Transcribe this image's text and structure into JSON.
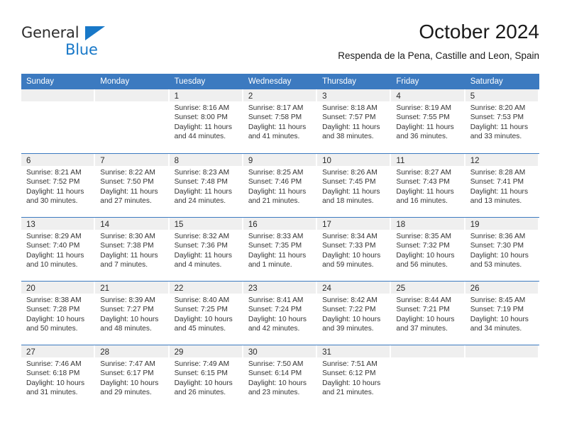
{
  "brand": {
    "name_part1": "General",
    "name_part2": "Blue",
    "triangle_color": "#1878c8"
  },
  "header": {
    "title": "October 2024",
    "subtitle": "Respenda de la Pena, Castille and Leon, Spain"
  },
  "theme": {
    "header_blue": "#3c7ac0",
    "band_gray": "#efefef",
    "text_color": "#333333"
  },
  "weekdays": [
    "Sunday",
    "Monday",
    "Tuesday",
    "Wednesday",
    "Thursday",
    "Friday",
    "Saturday"
  ],
  "weeks": [
    [
      {
        "day": ""
      },
      {
        "day": ""
      },
      {
        "day": "1",
        "sunrise": "Sunrise: 8:16 AM",
        "sunset": "Sunset: 8:00 PM",
        "daylight1": "Daylight: 11 hours",
        "daylight2": "and 44 minutes."
      },
      {
        "day": "2",
        "sunrise": "Sunrise: 8:17 AM",
        "sunset": "Sunset: 7:58 PM",
        "daylight1": "Daylight: 11 hours",
        "daylight2": "and 41 minutes."
      },
      {
        "day": "3",
        "sunrise": "Sunrise: 8:18 AM",
        "sunset": "Sunset: 7:57 PM",
        "daylight1": "Daylight: 11 hours",
        "daylight2": "and 38 minutes."
      },
      {
        "day": "4",
        "sunrise": "Sunrise: 8:19 AM",
        "sunset": "Sunset: 7:55 PM",
        "daylight1": "Daylight: 11 hours",
        "daylight2": "and 36 minutes."
      },
      {
        "day": "5",
        "sunrise": "Sunrise: 8:20 AM",
        "sunset": "Sunset: 7:53 PM",
        "daylight1": "Daylight: 11 hours",
        "daylight2": "and 33 minutes."
      }
    ],
    [
      {
        "day": "6",
        "sunrise": "Sunrise: 8:21 AM",
        "sunset": "Sunset: 7:52 PM",
        "daylight1": "Daylight: 11 hours",
        "daylight2": "and 30 minutes."
      },
      {
        "day": "7",
        "sunrise": "Sunrise: 8:22 AM",
        "sunset": "Sunset: 7:50 PM",
        "daylight1": "Daylight: 11 hours",
        "daylight2": "and 27 minutes."
      },
      {
        "day": "8",
        "sunrise": "Sunrise: 8:23 AM",
        "sunset": "Sunset: 7:48 PM",
        "daylight1": "Daylight: 11 hours",
        "daylight2": "and 24 minutes."
      },
      {
        "day": "9",
        "sunrise": "Sunrise: 8:25 AM",
        "sunset": "Sunset: 7:46 PM",
        "daylight1": "Daylight: 11 hours",
        "daylight2": "and 21 minutes."
      },
      {
        "day": "10",
        "sunrise": "Sunrise: 8:26 AM",
        "sunset": "Sunset: 7:45 PM",
        "daylight1": "Daylight: 11 hours",
        "daylight2": "and 18 minutes."
      },
      {
        "day": "11",
        "sunrise": "Sunrise: 8:27 AM",
        "sunset": "Sunset: 7:43 PM",
        "daylight1": "Daylight: 11 hours",
        "daylight2": "and 16 minutes."
      },
      {
        "day": "12",
        "sunrise": "Sunrise: 8:28 AM",
        "sunset": "Sunset: 7:41 PM",
        "daylight1": "Daylight: 11 hours",
        "daylight2": "and 13 minutes."
      }
    ],
    [
      {
        "day": "13",
        "sunrise": "Sunrise: 8:29 AM",
        "sunset": "Sunset: 7:40 PM",
        "daylight1": "Daylight: 11 hours",
        "daylight2": "and 10 minutes."
      },
      {
        "day": "14",
        "sunrise": "Sunrise: 8:30 AM",
        "sunset": "Sunset: 7:38 PM",
        "daylight1": "Daylight: 11 hours",
        "daylight2": "and 7 minutes."
      },
      {
        "day": "15",
        "sunrise": "Sunrise: 8:32 AM",
        "sunset": "Sunset: 7:36 PM",
        "daylight1": "Daylight: 11 hours",
        "daylight2": "and 4 minutes."
      },
      {
        "day": "16",
        "sunrise": "Sunrise: 8:33 AM",
        "sunset": "Sunset: 7:35 PM",
        "daylight1": "Daylight: 11 hours",
        "daylight2": "and 1 minute."
      },
      {
        "day": "17",
        "sunrise": "Sunrise: 8:34 AM",
        "sunset": "Sunset: 7:33 PM",
        "daylight1": "Daylight: 10 hours",
        "daylight2": "and 59 minutes."
      },
      {
        "day": "18",
        "sunrise": "Sunrise: 8:35 AM",
        "sunset": "Sunset: 7:32 PM",
        "daylight1": "Daylight: 10 hours",
        "daylight2": "and 56 minutes."
      },
      {
        "day": "19",
        "sunrise": "Sunrise: 8:36 AM",
        "sunset": "Sunset: 7:30 PM",
        "daylight1": "Daylight: 10 hours",
        "daylight2": "and 53 minutes."
      }
    ],
    [
      {
        "day": "20",
        "sunrise": "Sunrise: 8:38 AM",
        "sunset": "Sunset: 7:28 PM",
        "daylight1": "Daylight: 10 hours",
        "daylight2": "and 50 minutes."
      },
      {
        "day": "21",
        "sunrise": "Sunrise: 8:39 AM",
        "sunset": "Sunset: 7:27 PM",
        "daylight1": "Daylight: 10 hours",
        "daylight2": "and 48 minutes."
      },
      {
        "day": "22",
        "sunrise": "Sunrise: 8:40 AM",
        "sunset": "Sunset: 7:25 PM",
        "daylight1": "Daylight: 10 hours",
        "daylight2": "and 45 minutes."
      },
      {
        "day": "23",
        "sunrise": "Sunrise: 8:41 AM",
        "sunset": "Sunset: 7:24 PM",
        "daylight1": "Daylight: 10 hours",
        "daylight2": "and 42 minutes."
      },
      {
        "day": "24",
        "sunrise": "Sunrise: 8:42 AM",
        "sunset": "Sunset: 7:22 PM",
        "daylight1": "Daylight: 10 hours",
        "daylight2": "and 39 minutes."
      },
      {
        "day": "25",
        "sunrise": "Sunrise: 8:44 AM",
        "sunset": "Sunset: 7:21 PM",
        "daylight1": "Daylight: 10 hours",
        "daylight2": "and 37 minutes."
      },
      {
        "day": "26",
        "sunrise": "Sunrise: 8:45 AM",
        "sunset": "Sunset: 7:19 PM",
        "daylight1": "Daylight: 10 hours",
        "daylight2": "and 34 minutes."
      }
    ],
    [
      {
        "day": "27",
        "sunrise": "Sunrise: 7:46 AM",
        "sunset": "Sunset: 6:18 PM",
        "daylight1": "Daylight: 10 hours",
        "daylight2": "and 31 minutes."
      },
      {
        "day": "28",
        "sunrise": "Sunrise: 7:47 AM",
        "sunset": "Sunset: 6:17 PM",
        "daylight1": "Daylight: 10 hours",
        "daylight2": "and 29 minutes."
      },
      {
        "day": "29",
        "sunrise": "Sunrise: 7:49 AM",
        "sunset": "Sunset: 6:15 PM",
        "daylight1": "Daylight: 10 hours",
        "daylight2": "and 26 minutes."
      },
      {
        "day": "30",
        "sunrise": "Sunrise: 7:50 AM",
        "sunset": "Sunset: 6:14 PM",
        "daylight1": "Daylight: 10 hours",
        "daylight2": "and 23 minutes."
      },
      {
        "day": "31",
        "sunrise": "Sunrise: 7:51 AM",
        "sunset": "Sunset: 6:12 PM",
        "daylight1": "Daylight: 10 hours",
        "daylight2": "and 21 minutes."
      },
      {
        "day": ""
      },
      {
        "day": ""
      }
    ]
  ]
}
